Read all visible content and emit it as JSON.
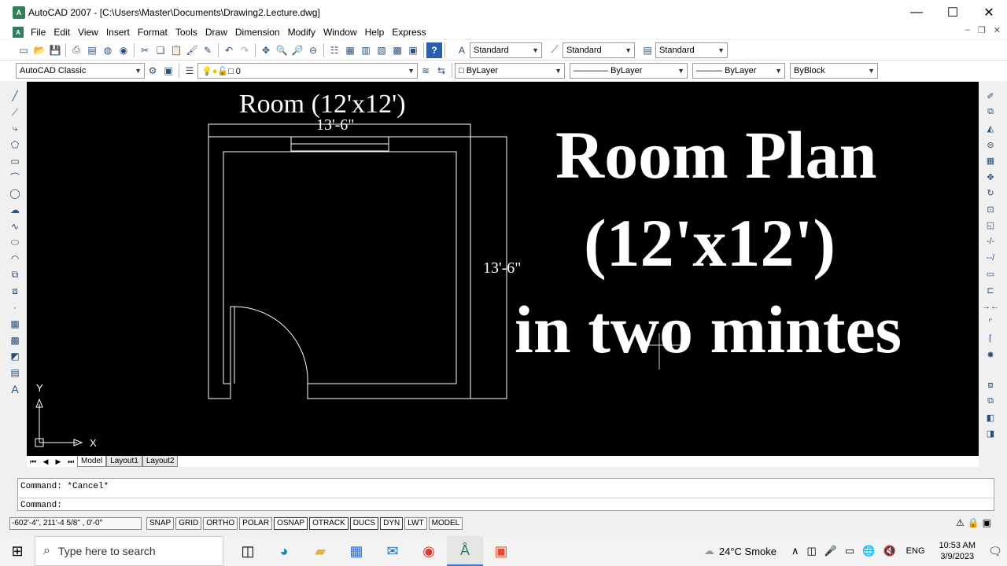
{
  "window": {
    "title": "AutoCAD 2007 - [C:\\Users\\Master\\Documents\\Drawing2.Lecture.dwg]",
    "controls": [
      "—",
      "☐",
      "✕"
    ]
  },
  "menu": [
    "File",
    "Edit",
    "View",
    "Insert",
    "Format",
    "Tools",
    "Draw",
    "Dimension",
    "Modify",
    "Window",
    "Help",
    "Express"
  ],
  "toolbar": {
    "text_style": "Standard",
    "dim_style": "Standard",
    "table_style": "Standard",
    "workspace": "AutoCAD Classic",
    "layer": "0",
    "color": "ByLayer",
    "linetype": "ByLayer",
    "lineweight": "ByLayer",
    "plotstyle": "ByBlock"
  },
  "drawing": {
    "room_title": "Room (12'x12')",
    "dim_top": "13'-6\"",
    "dim_right": "13'-6\"",
    "big_line1": "Room Plan",
    "big_line2": "(12'x12')",
    "big_line3": "in two mintes",
    "ucs_y": "Y",
    "ucs_x": "X"
  },
  "tabs": [
    "Model",
    "Layout1",
    "Layout2"
  ],
  "command": {
    "line1": "Command: *Cancel*",
    "line2": "Command:"
  },
  "status": {
    "coords": "-602'-4\",  211'-4 5/8\" , 0'-0\"",
    "buttons": [
      "SNAP",
      "GRID",
      "ORTHO",
      "POLAR",
      "OSNAP",
      "OTRACK",
      "DUCS",
      "DYN",
      "LWT",
      "MODEL"
    ]
  },
  "taskbar": {
    "search_placeholder": "Type here to search",
    "weather": "24°C  Smoke",
    "lang": "ENG",
    "time": "10:53 AM",
    "date": "3/9/2023"
  }
}
